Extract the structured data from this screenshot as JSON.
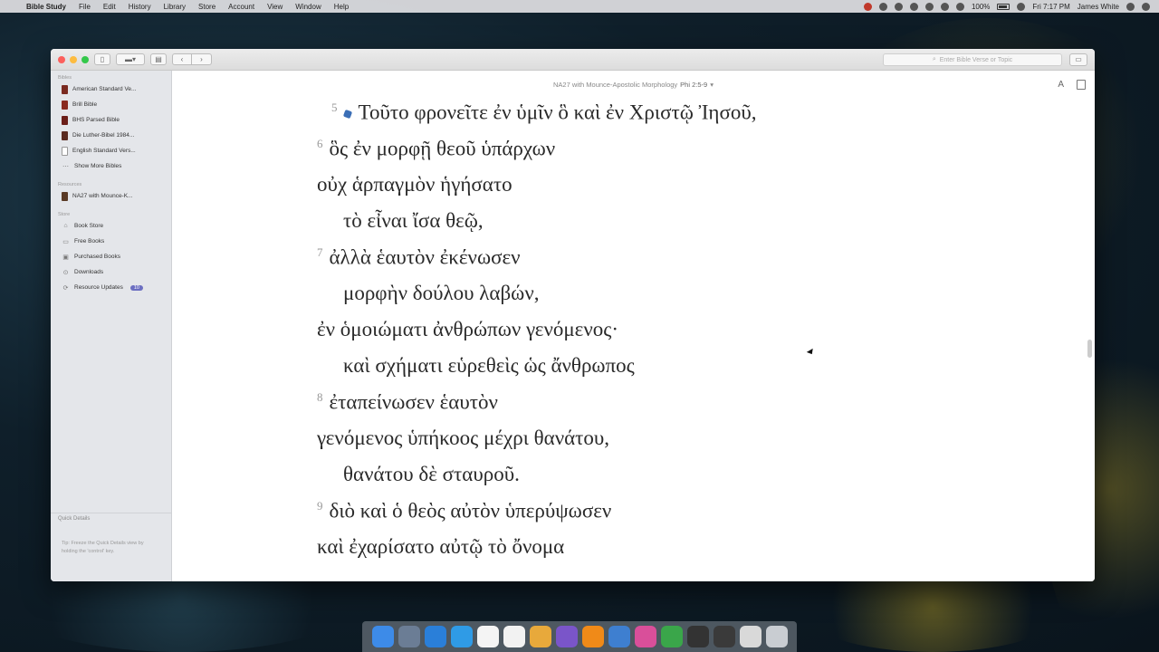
{
  "menubar": {
    "app_name": "Bible Study",
    "items": [
      "File",
      "Edit",
      "History",
      "Library",
      "Store",
      "Account",
      "View",
      "Window",
      "Help"
    ],
    "battery": "100%",
    "time": "Fri 7:17 PM",
    "user": "James White"
  },
  "toolbar": {
    "back_label": "‹",
    "forward_label": "›",
    "search_placeholder": "Enter Bible Verse or Topic"
  },
  "sidebar": {
    "section_bibles": "Bibles",
    "bibles": [
      {
        "label": "American Standard Ve...",
        "color": "#7a2a20"
      },
      {
        "label": "Brill Bible",
        "color": "#8a2a1f"
      },
      {
        "label": "BHS Parsed Bible",
        "color": "#6b1e18"
      },
      {
        "label": "Die Luther-Bibel 1984...",
        "color": "#5a2a20"
      },
      {
        "label": "English Standard Vers...",
        "color": "#ffffff"
      },
      {
        "label": "Show More Bibles",
        "color": ""
      }
    ],
    "section_resources": "Resources",
    "resources": [
      {
        "label": "NA27 with Mounce-K..."
      }
    ],
    "section_store": "Store",
    "store": [
      {
        "label": "Book Store",
        "icon": "cart-icon"
      },
      {
        "label": "Free Books",
        "icon": "gift-icon"
      },
      {
        "label": "Purchased Books",
        "icon": "bag-icon"
      },
      {
        "label": "Downloads",
        "icon": "download-icon"
      },
      {
        "label": "Resource Updates",
        "icon": "refresh-icon",
        "badge": "10"
      }
    ],
    "quick_details_label": "Quick Details",
    "quick_details_tip": "Tip: Freeze the Quick Details view by holding the 'control' key."
  },
  "document": {
    "title": "NA27 with Mounce-Apostolic Morphology",
    "reference": "Phi 2:5-9"
  },
  "verses": [
    {
      "num": "5",
      "text": "Τοῦτο φρονεῖτε ἐν ὑμῖν ὃ καὶ ἐν Χριστῷ Ἰησοῦ,",
      "note": true
    },
    {
      "num": "6",
      "text": "ὃς ἐν μορφῇ θεοῦ ὑπάρχων"
    },
    {
      "num": "",
      "text": "οὐχ ἁρπαγμὸν ἡγήσατο"
    },
    {
      "num": "",
      "text": "τὸ εἶναι ἴσα θεῷ,"
    },
    {
      "num": "7",
      "text": "ἀλλὰ ἑαυτὸν ἐκένωσεν"
    },
    {
      "num": "",
      "text": "μορφὴν δούλου λαβών,"
    },
    {
      "num": "",
      "text": "ἐν ὁμοιώματι ἀνθρώπων γενόμενος·"
    },
    {
      "num": "",
      "text": "καὶ σχήματι εὑρεθεὶς ὡς ἄνθρωπος"
    },
    {
      "num": "8",
      "text": "ἐταπείνωσεν ἑαυτὸν"
    },
    {
      "num": "",
      "text": "γενόμενος ὑπήκοος μέχρι θανάτου,"
    },
    {
      "num": "",
      "text": "θανάτου δὲ σταυροῦ."
    },
    {
      "num": "9",
      "text": "διὸ καὶ ὁ θεὸς αὐτὸν ὑπερύψωσεν"
    },
    {
      "num": "",
      "text": "καὶ ἐχαρίσατο αὐτῷ τὸ ὄνομα"
    }
  ],
  "dock_apps": [
    {
      "name": "finder",
      "color": "#3d8be8"
    },
    {
      "name": "launchpad",
      "color": "#6b7d95"
    },
    {
      "name": "app-store",
      "color": "#2a7fd9"
    },
    {
      "name": "safari",
      "color": "#2f9be6"
    },
    {
      "name": "calendar",
      "color": "#f4f4f4"
    },
    {
      "name": "notes",
      "color": "#f2f2f2"
    },
    {
      "name": "chrome",
      "color": "#e8a93b"
    },
    {
      "name": "bible-study",
      "color": "#7a55c9"
    },
    {
      "name": "vlc",
      "color": "#f08a18"
    },
    {
      "name": "keynote",
      "color": "#3e7fd0"
    },
    {
      "name": "itunes",
      "color": "#d94f9a"
    },
    {
      "name": "camtasia",
      "color": "#3aa64a"
    },
    {
      "name": "screen-1",
      "color": "#333333"
    },
    {
      "name": "screen-2",
      "color": "#3a3a3a"
    },
    {
      "name": "screen-3",
      "color": "#d9d9d9"
    },
    {
      "name": "trash",
      "color": "#c9cdd2"
    }
  ]
}
